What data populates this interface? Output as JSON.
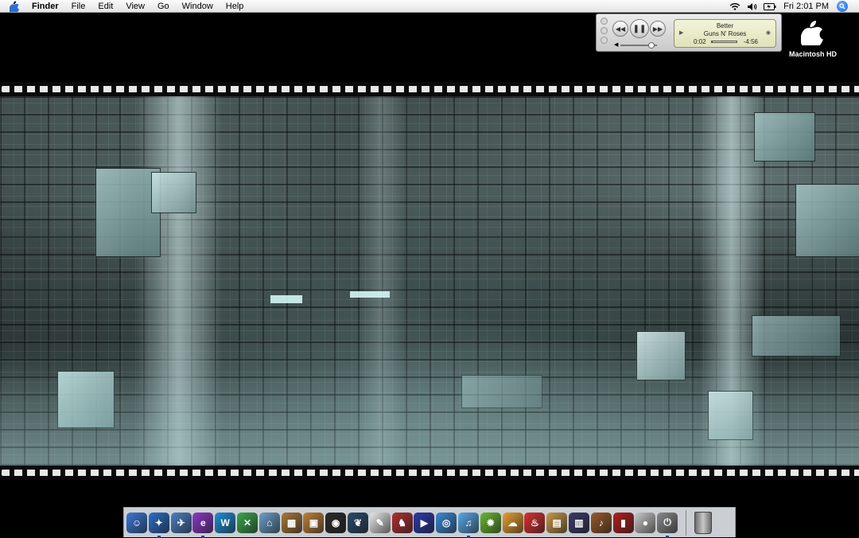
{
  "menubar": {
    "app_name": "Finder",
    "menus": [
      "File",
      "Edit",
      "View",
      "Go",
      "Window",
      "Help"
    ],
    "clock": "Fri 2:01 PM",
    "status_icons": [
      "wifi-icon",
      "volume-icon",
      "battery-icon"
    ]
  },
  "miniplayer": {
    "track": "Better",
    "artist": "Guns N' Roses",
    "elapsed": "0:02",
    "remaining": "-4:56",
    "progress_fraction": 0.01,
    "volume_fraction": 0.8
  },
  "desktop": {
    "drive_label": "Macintosh HD"
  },
  "dock": {
    "items": [
      {
        "name": "finder-icon",
        "color": "#3a78d8",
        "glyph": "☺"
      },
      {
        "name": "safari-icon",
        "color": "#2a6fc9",
        "glyph": "✦"
      },
      {
        "name": "mail-icon",
        "color": "#4b7fc4",
        "glyph": "✈"
      },
      {
        "name": "app-e-icon",
        "color": "#8a38c8",
        "glyph": "e"
      },
      {
        "name": "app-w-icon",
        "color": "#1e8fd6",
        "glyph": "W"
      },
      {
        "name": "app-x-icon",
        "color": "#3aa84a",
        "glyph": "✕"
      },
      {
        "name": "preview-icon",
        "color": "#6aa0c8",
        "glyph": "⌂"
      },
      {
        "name": "photo-app-icon",
        "color": "#a8783a",
        "glyph": "▦"
      },
      {
        "name": "iphoto-icon",
        "color": "#c0813a",
        "glyph": "▣"
      },
      {
        "name": "camera-icon",
        "color": "#2a2a2a",
        "glyph": "◉"
      },
      {
        "name": "feather-icon",
        "color": "#2a4a6a",
        "glyph": "❦"
      },
      {
        "name": "textedit-icon",
        "color": "#e8e8e8",
        "glyph": "✎"
      },
      {
        "name": "game-icon",
        "color": "#b03030",
        "glyph": "♞"
      },
      {
        "name": "imovie-icon",
        "color": "#2a3aa8",
        "glyph": "▶"
      },
      {
        "name": "dvd-icon",
        "color": "#3a8ad8",
        "glyph": "◎"
      },
      {
        "name": "itunes-icon",
        "color": "#58a8e8",
        "glyph": "♫"
      },
      {
        "name": "burn-icon",
        "color": "#6ab830",
        "glyph": "✹"
      },
      {
        "name": "ichat-icon",
        "color": "#e8a030",
        "glyph": "☁"
      },
      {
        "name": "popcorn-icon",
        "color": "#d83030",
        "glyph": "♨"
      },
      {
        "name": "notebook-icon",
        "color": "#c89848",
        "glyph": "▤"
      },
      {
        "name": "photo-booth-icon",
        "color": "#3a3a6a",
        "glyph": "▥"
      },
      {
        "name": "guitar-icon",
        "color": "#9a5a2a",
        "glyph": "♪"
      },
      {
        "name": "red-book-icon",
        "color": "#b02020",
        "glyph": "▮"
      },
      {
        "name": "apple-app-icon",
        "color": "#c8c8c8",
        "glyph": "●"
      },
      {
        "name": "power-icon",
        "color": "#8a8a8a",
        "glyph": "⏻"
      }
    ],
    "running_indices": [
      1,
      3,
      15,
      24
    ]
  }
}
